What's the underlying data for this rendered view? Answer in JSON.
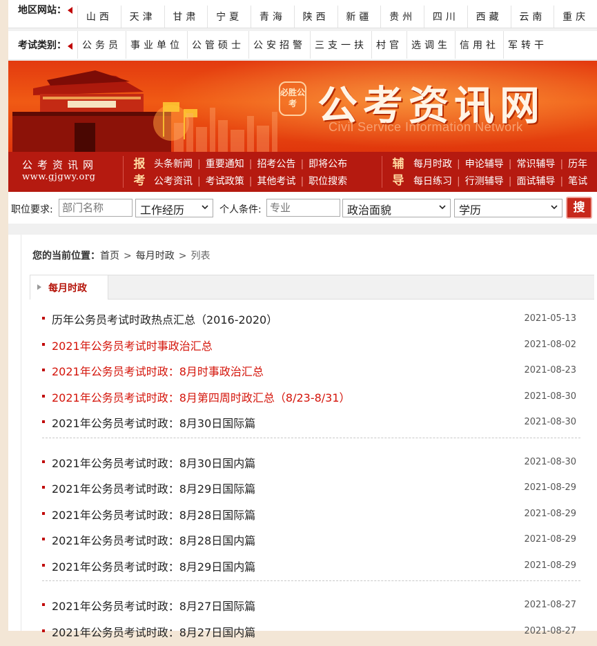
{
  "nav": {
    "region_label": "地区网站：",
    "regions": [
      "山西",
      "天津",
      "甘肃",
      "宁夏",
      "青海",
      "陕西",
      "新疆",
      "贵州",
      "四川",
      "西藏",
      "云南",
      "重庆"
    ],
    "exam_label": "考试类别：",
    "exams": [
      "公务员",
      "事业单位",
      "公管硕士",
      "公安招警",
      "三支一扶",
      "村官",
      "选调生",
      "信用社",
      "军转干"
    ]
  },
  "banner": {
    "seal_text": "必胜公考",
    "title": "公考资讯网",
    "subtitle_en": "Civil Service Information Network"
  },
  "menu": {
    "brand_cn": "公考资讯网",
    "brand_url": "www.gjgwy.org",
    "group1_tag": [
      "报",
      "考"
    ],
    "group1_rows": [
      [
        "头条新闻",
        "重要通知",
        "招考公告",
        "即将公布"
      ],
      [
        "公考资讯",
        "考试政策",
        "其他考试",
        "职位搜索"
      ]
    ],
    "group2_tag": [
      "辅",
      "导"
    ],
    "group2_rows": [
      [
        "每月时政",
        "申论辅导",
        "常识辅导",
        "历年"
      ],
      [
        "每日练习",
        "行测辅导",
        "面试辅导",
        "笔试"
      ]
    ]
  },
  "search": {
    "position_label": "职位要求:",
    "dept_placeholder": "部门名称",
    "experience": "工作经历",
    "personal_label": "个人条件:",
    "major_placeholder": "专业",
    "politics": "政治面貌",
    "education": "学历",
    "button": "搜"
  },
  "breadcrumb": {
    "label": "您的当前位置：",
    "home": "首页",
    "section": "每月时政",
    "current": "列表"
  },
  "tab": {
    "label": "每月时政"
  },
  "articles": [
    {
      "title": "历年公务员考试时政热点汇总（2016-2020）",
      "date": "2021-05-13",
      "hot": false
    },
    {
      "title": "2021年公务员考试时事政治汇总",
      "date": "2021-08-02",
      "hot": true
    },
    {
      "title": "2021年公务员考试时政：8月时事政治汇总",
      "date": "2021-08-23",
      "hot": true
    },
    {
      "title": "2021年公务员考试时政：8月第四周时政汇总（8/23-8/31）",
      "date": "2021-08-30",
      "hot": true
    },
    {
      "title": "2021年公务员考试时政：8月30日国际篇",
      "date": "2021-08-30",
      "hot": false
    },
    {
      "title": "2021年公务员考试时政：8月30日国内篇",
      "date": "2021-08-30",
      "hot": false
    },
    {
      "title": "2021年公务员考试时政：8月29日国际篇",
      "date": "2021-08-29",
      "hot": false
    },
    {
      "title": "2021年公务员考试时政：8月28日国际篇",
      "date": "2021-08-29",
      "hot": false
    },
    {
      "title": "2021年公务员考试时政：8月28日国内篇",
      "date": "2021-08-29",
      "hot": false
    },
    {
      "title": "2021年公务员考试时政：8月29日国内篇",
      "date": "2021-08-29",
      "hot": false
    },
    {
      "title": "2021年公务员考试时政：8月27日国际篇",
      "date": "2021-08-27",
      "hot": false
    },
    {
      "title": "2021年公务员考试时政：8月27日国内篇",
      "date": "2021-08-27",
      "hot": false
    }
  ],
  "colors": {
    "brand_red": "#b51a10",
    "hot_text": "#d4140a",
    "accent_orange": "#f05a14"
  }
}
